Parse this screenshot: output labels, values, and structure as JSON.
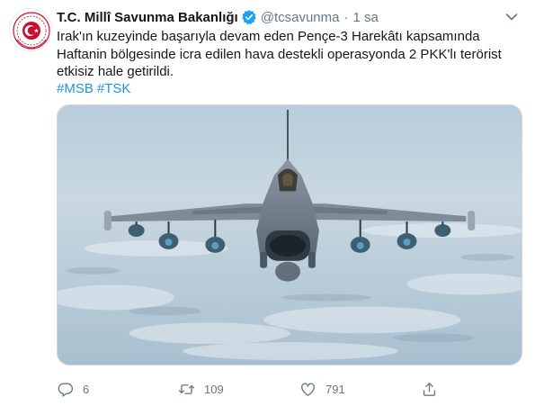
{
  "tweet": {
    "author_name": "T.C. Millî Savunma Bakanlığı",
    "handle": "@tcsavunma",
    "separator": "·",
    "time": "1 sa",
    "text_lines": [
      "Irak'ın kuzeyinde başarıyla devam eden Pençe-3 Harekâtı kapsamında",
      "Haftanin bölgesinde icra edilen hava destekli operasyonda 2 PKK'lı terörist",
      "etkisiz hale getirildi."
    ],
    "hashtags": [
      "#MSB",
      "#TSK"
    ],
    "media_icon": "fighter-jet-photo"
  },
  "actions": {
    "reply_count": "6",
    "retweet_count": "109",
    "like_count": "791"
  },
  "icons": {
    "avatar": "turkish-emblem-avatar",
    "verified": "verified-badge-icon",
    "more": "chevron-down-icon",
    "reply": "reply-icon",
    "retweet": "retweet-icon",
    "like": "heart-icon",
    "share": "share-icon"
  },
  "colors": {
    "accent": "#1b95e0",
    "text": "#14171a",
    "muted": "#657786",
    "emblem_red": "#c8102e"
  }
}
